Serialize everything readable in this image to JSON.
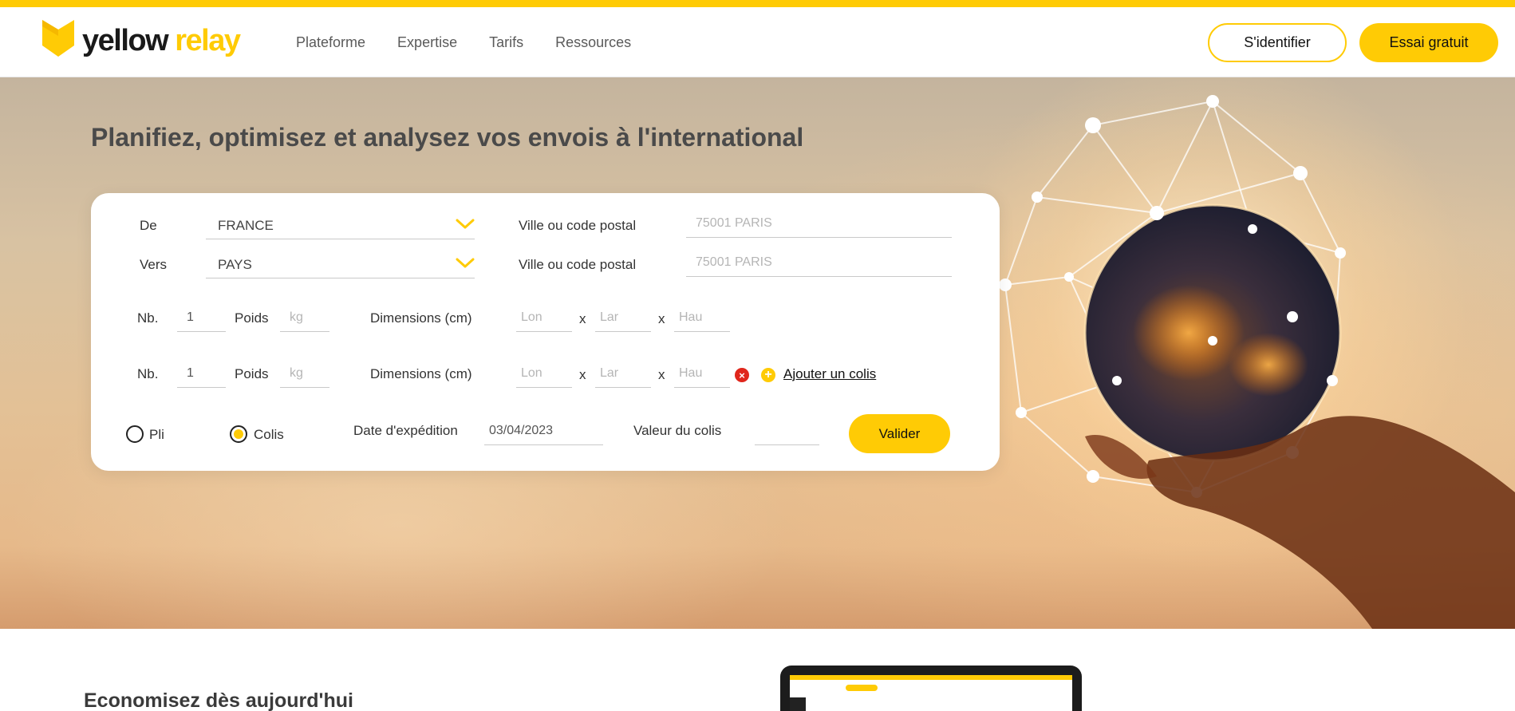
{
  "brand": {
    "word1": "yellow",
    "word2": "relay",
    "accent": "#ffcb05"
  },
  "nav": {
    "items": [
      "Plateforme",
      "Expertise",
      "Tarifs",
      "Ressources"
    ]
  },
  "header": {
    "login_label": "S'identifier",
    "trial_label": "Essai gratuit"
  },
  "hero": {
    "title": "Planifiez, optimisez et analysez vos envois à l'international"
  },
  "form": {
    "from": {
      "label": "De",
      "value": "FRANCE"
    },
    "to": {
      "label": "Vers",
      "value": "PAYS"
    },
    "city_label": "Ville ou code postal",
    "city_placeholder": "75001 PARIS",
    "parcels": [
      {
        "nb_label": "Nb.",
        "nb_value": "1",
        "weight_label": "Poids",
        "weight_placeholder": "kg",
        "dims_label": "Dimensions (cm)",
        "len_placeholder": "Lon",
        "wid_placeholder": "Lar",
        "hei_placeholder": "Hau"
      },
      {
        "nb_label": "Nb.",
        "nb_value": "1",
        "weight_label": "Poids",
        "weight_placeholder": "kg",
        "dims_label": "Dimensions (cm)",
        "len_placeholder": "Lon",
        "wid_placeholder": "Lar",
        "hei_placeholder": "Hau"
      }
    ],
    "times": "x",
    "add_parcel_label": "Ajouter un colis",
    "type_options": [
      "Pli",
      "Colis"
    ],
    "type_selected": "Colis",
    "ship_date_label": "Date d'expédition",
    "ship_date_value": "03/04/2023",
    "value_label": "Valeur du colis",
    "validate_label": "Valider"
  },
  "section": {
    "title": "Economisez dès aujourd'hui"
  }
}
